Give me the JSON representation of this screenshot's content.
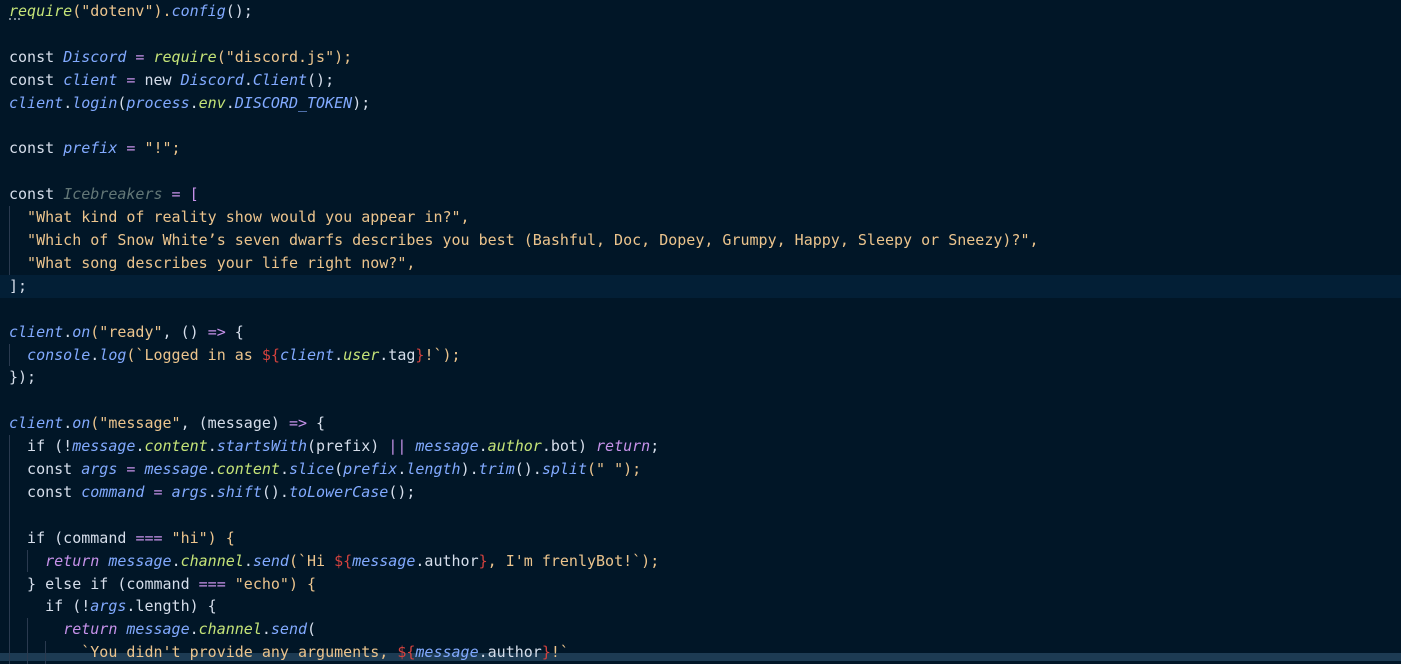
{
  "colors": {
    "background": "#011627",
    "current_line": "#031f36",
    "indent_guide": "#2a3a4f",
    "plain": "#d6deeb",
    "string": "#ecc48d",
    "keyword": "#c792ea",
    "function": "#82aaff",
    "method": "#c5e478",
    "variable": "#7fdbca",
    "template_punct": "#d3423e"
  },
  "editor": {
    "current_line_index": 12,
    "lines": [
      [
        {
          "t": "require",
          "c": "fn2"
        },
        {
          "t": "(\"dotenv\").",
          "c": "str"
        },
        {
          "t": "config",
          "c": "fn"
        },
        {
          "t": "();",
          "c": "plain"
        }
      ],
      [],
      [
        {
          "t": "const ",
          "c": "plain"
        },
        {
          "t": "Discord",
          "c": "fn"
        },
        {
          "t": " = ",
          "c": "op"
        },
        {
          "t": "require",
          "c": "fn2"
        },
        {
          "t": "(\"discord.js\");",
          "c": "str"
        }
      ],
      [
        {
          "t": "const ",
          "c": "plain"
        },
        {
          "t": "client",
          "c": "fn"
        },
        {
          "t": " = ",
          "c": "op"
        },
        {
          "t": "new ",
          "c": "plain"
        },
        {
          "t": "Discord",
          "c": "fn"
        },
        {
          "t": ".",
          "c": "plain"
        },
        {
          "t": "Client",
          "c": "fn"
        },
        {
          "t": "();",
          "c": "plain"
        }
      ],
      [
        {
          "t": "client",
          "c": "fn"
        },
        {
          "t": ".",
          "c": "plain"
        },
        {
          "t": "login",
          "c": "fn"
        },
        {
          "t": "(",
          "c": "plain"
        },
        {
          "t": "process",
          "c": "fn"
        },
        {
          "t": ".",
          "c": "plain"
        },
        {
          "t": "env",
          "c": "fn2"
        },
        {
          "t": ".",
          "c": "plain"
        },
        {
          "t": "DISCORD_TOKEN",
          "c": "fn"
        },
        {
          "t": ");",
          "c": "plain"
        }
      ],
      [],
      [
        {
          "t": "const ",
          "c": "plain"
        },
        {
          "t": "prefix",
          "c": "fn"
        },
        {
          "t": " = ",
          "c": "op"
        },
        {
          "t": "\"!\";",
          "c": "str"
        }
      ],
      [],
      [
        {
          "t": "const ",
          "c": "plain"
        },
        {
          "t": "Icebreakers",
          "c": "dim"
        },
        {
          "t": " = [",
          "c": "op"
        }
      ],
      [
        {
          "t": "  \"What kind of reality show would you appear in?\",",
          "c": "str"
        }
      ],
      [
        {
          "t": "  \"Which of Snow White’s seven dwarfs describes you best (Bashful, Doc, Dopey, Grumpy, Happy, Sleepy or Sneezy)?\",",
          "c": "str"
        }
      ],
      [
        {
          "t": "  \"What song describes your life right now?\",",
          "c": "str"
        }
      ],
      [
        {
          "t": "];",
          "c": "plain"
        }
      ],
      [],
      [
        {
          "t": "client",
          "c": "fn"
        },
        {
          "t": ".",
          "c": "plain"
        },
        {
          "t": "on",
          "c": "fn"
        },
        {
          "t": "(\"ready\"",
          "c": "str"
        },
        {
          "t": ", () ",
          "c": "plain"
        },
        {
          "t": "=>",
          "c": "op"
        },
        {
          "t": " {",
          "c": "plain"
        }
      ],
      [
        {
          "t": "  ",
          "c": "plain"
        },
        {
          "t": "console",
          "c": "fn"
        },
        {
          "t": ".",
          "c": "plain"
        },
        {
          "t": "log",
          "c": "fn"
        },
        {
          "t": "(`Logged in as ",
          "c": "str"
        },
        {
          "t": "${",
          "c": "tpl"
        },
        {
          "t": "client",
          "c": "fn"
        },
        {
          "t": ".",
          "c": "plain"
        },
        {
          "t": "user",
          "c": "fn2"
        },
        {
          "t": ".tag",
          "c": "plain"
        },
        {
          "t": "}",
          "c": "tpl"
        },
        {
          "t": "!`);",
          "c": "str"
        }
      ],
      [
        {
          "t": "});",
          "c": "plain"
        }
      ],
      [],
      [
        {
          "t": "client",
          "c": "fn"
        },
        {
          "t": ".",
          "c": "plain"
        },
        {
          "t": "on",
          "c": "fn"
        },
        {
          "t": "(\"message\"",
          "c": "str"
        },
        {
          "t": ", (message) ",
          "c": "plain"
        },
        {
          "t": "=>",
          "c": "op"
        },
        {
          "t": " {",
          "c": "plain"
        }
      ],
      [
        {
          "t": "  if (!",
          "c": "plain"
        },
        {
          "t": "message",
          "c": "fn"
        },
        {
          "t": ".",
          "c": "plain"
        },
        {
          "t": "content",
          "c": "fn2"
        },
        {
          "t": ".",
          "c": "plain"
        },
        {
          "t": "startsWith",
          "c": "fn"
        },
        {
          "t": "(prefix) ",
          "c": "plain"
        },
        {
          "t": "||",
          "c": "op"
        },
        {
          "t": " ",
          "c": "plain"
        },
        {
          "t": "message",
          "c": "fn"
        },
        {
          "t": ".",
          "c": "plain"
        },
        {
          "t": "author",
          "c": "fn2"
        },
        {
          "t": ".bot) ",
          "c": "plain"
        },
        {
          "t": "return",
          "c": "ret"
        },
        {
          "t": ";",
          "c": "plain"
        }
      ],
      [
        {
          "t": "  const ",
          "c": "plain"
        },
        {
          "t": "args",
          "c": "fn"
        },
        {
          "t": " = ",
          "c": "op"
        },
        {
          "t": "message",
          "c": "fn"
        },
        {
          "t": ".",
          "c": "plain"
        },
        {
          "t": "content",
          "c": "fn2"
        },
        {
          "t": ".",
          "c": "plain"
        },
        {
          "t": "slice",
          "c": "fn"
        },
        {
          "t": "(",
          "c": "plain"
        },
        {
          "t": "prefix",
          "c": "fn"
        },
        {
          "t": ".",
          "c": "plain"
        },
        {
          "t": "length",
          "c": "fn"
        },
        {
          "t": ").",
          "c": "plain"
        },
        {
          "t": "trim",
          "c": "fn"
        },
        {
          "t": "().",
          "c": "plain"
        },
        {
          "t": "split",
          "c": "fn"
        },
        {
          "t": "(\" \");",
          "c": "str"
        }
      ],
      [
        {
          "t": "  const ",
          "c": "plain"
        },
        {
          "t": "command",
          "c": "fn"
        },
        {
          "t": " = ",
          "c": "op"
        },
        {
          "t": "args",
          "c": "fn"
        },
        {
          "t": ".",
          "c": "plain"
        },
        {
          "t": "shift",
          "c": "fn"
        },
        {
          "t": "().",
          "c": "plain"
        },
        {
          "t": "toLowerCase",
          "c": "fn"
        },
        {
          "t": "();",
          "c": "plain"
        }
      ],
      [],
      [
        {
          "t": "  if (command ",
          "c": "plain"
        },
        {
          "t": "===",
          "c": "op"
        },
        {
          "t": " \"hi\") {",
          "c": "str"
        }
      ],
      [
        {
          "t": "    ",
          "c": "plain"
        },
        {
          "t": "return",
          "c": "ret"
        },
        {
          "t": " ",
          "c": "plain"
        },
        {
          "t": "message",
          "c": "fn"
        },
        {
          "t": ".",
          "c": "plain"
        },
        {
          "t": "channel",
          "c": "fn2"
        },
        {
          "t": ".",
          "c": "plain"
        },
        {
          "t": "send",
          "c": "fn"
        },
        {
          "t": "(`Hi ",
          "c": "str"
        },
        {
          "t": "${",
          "c": "tpl"
        },
        {
          "t": "message",
          "c": "fn"
        },
        {
          "t": ".author",
          "c": "plain"
        },
        {
          "t": "}",
          "c": "tpl"
        },
        {
          "t": ", I'm frenlyBot!`);",
          "c": "str"
        }
      ],
      [
        {
          "t": "  } else if (command ",
          "c": "plain"
        },
        {
          "t": "===",
          "c": "op"
        },
        {
          "t": " \"echo\") {",
          "c": "str"
        }
      ],
      [
        {
          "t": "    if (!",
          "c": "plain"
        },
        {
          "t": "args",
          "c": "fn"
        },
        {
          "t": ".length) {",
          "c": "plain"
        }
      ],
      [
        {
          "t": "      ",
          "c": "plain"
        },
        {
          "t": "return",
          "c": "ret"
        },
        {
          "t": " ",
          "c": "plain"
        },
        {
          "t": "message",
          "c": "fn"
        },
        {
          "t": ".",
          "c": "plain"
        },
        {
          "t": "channel",
          "c": "fn2"
        },
        {
          "t": ".",
          "c": "plain"
        },
        {
          "t": "send",
          "c": "fn"
        },
        {
          "t": "(",
          "c": "plain"
        }
      ],
      [
        {
          "t": "        `You didn't provide any arguments, ",
          "c": "str"
        },
        {
          "t": "${",
          "c": "tpl"
        },
        {
          "t": "message",
          "c": "fn"
        },
        {
          "t": ".author",
          "c": "plain"
        },
        {
          "t": "}",
          "c": "tpl"
        },
        {
          "t": "!`",
          "c": "str"
        }
      ]
    ]
  }
}
